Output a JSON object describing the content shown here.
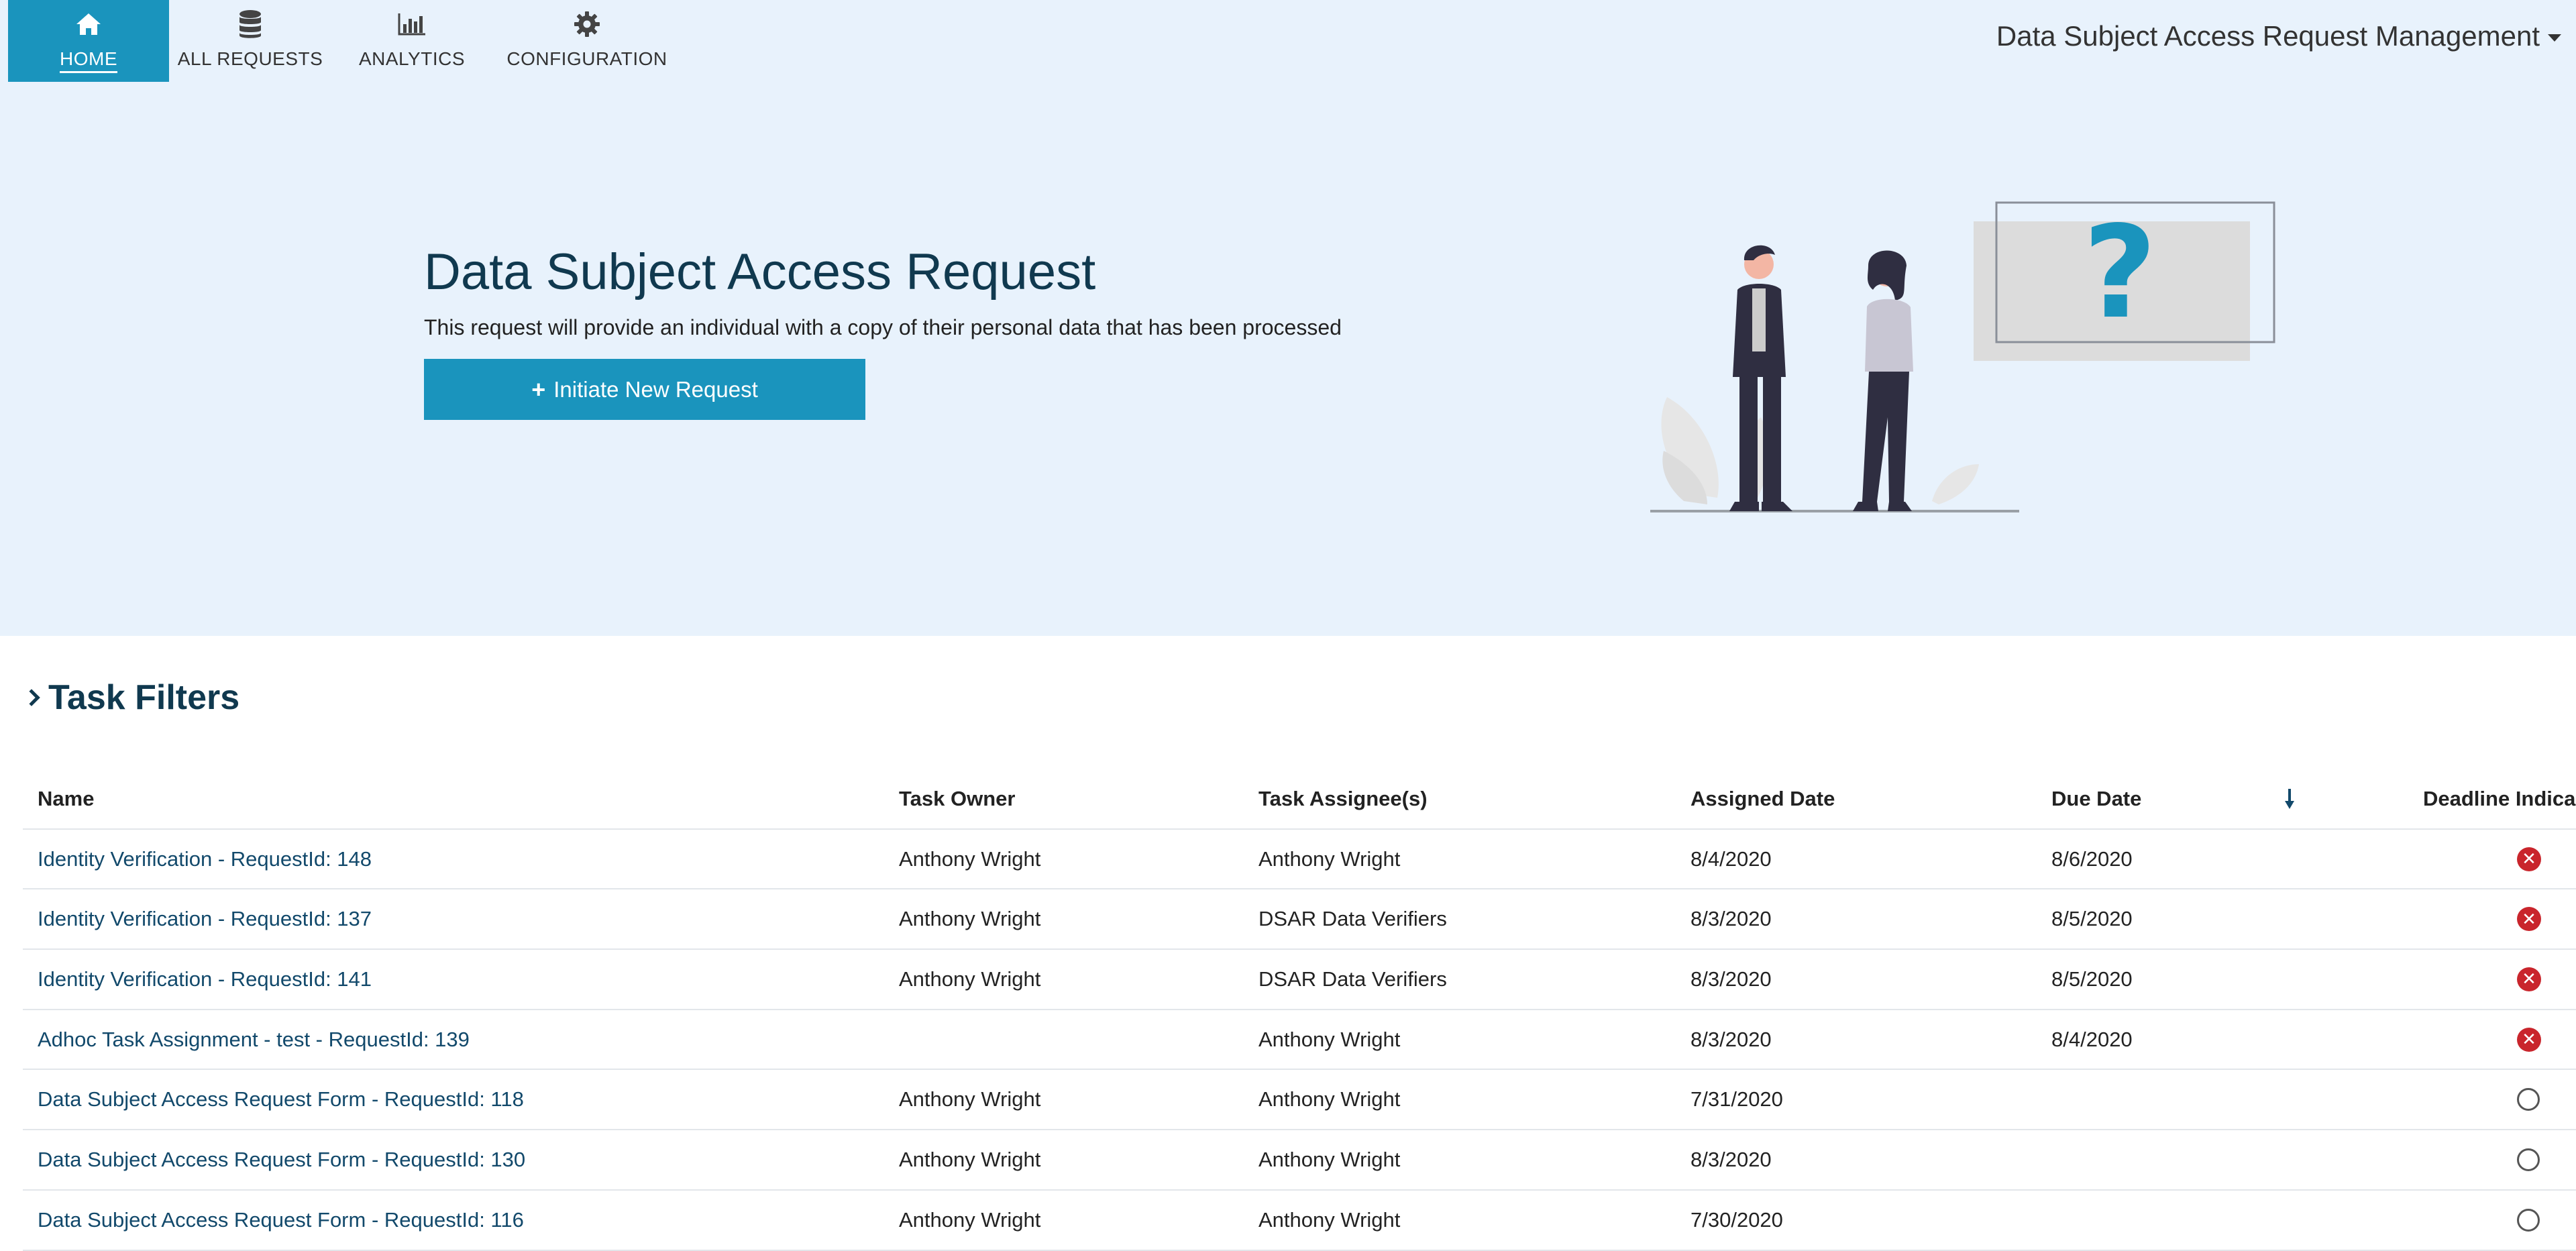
{
  "nav": {
    "items": [
      {
        "label": "HOME",
        "icon": "home-icon"
      },
      {
        "label": "ALL REQUESTS",
        "icon": "database-icon"
      },
      {
        "label": "ANALYTICS",
        "icon": "bar-chart-icon"
      },
      {
        "label": "CONFIGURATION",
        "icon": "gear-icon"
      }
    ],
    "app_title": "Data Subject Access Request Management"
  },
  "hero": {
    "title": "Data Subject Access Request",
    "description": "This request will provide an individual with a copy of their personal data that has been processed",
    "button_label": "Initiate New Request"
  },
  "filters": {
    "label": "Task Filters"
  },
  "table": {
    "headers": {
      "name": "Name",
      "owner": "Task Owner",
      "assignee": "Task Assignee(s)",
      "assigned": "Assigned Date",
      "due": "Due Date",
      "deadline": "Deadline Indica"
    },
    "rows": [
      {
        "name": "Identity Verification - RequestId: 148",
        "owner": "Anthony Wright",
        "assignee": "Anthony Wright",
        "assigned": "8/4/2020",
        "due": "8/6/2020",
        "status": "overdue"
      },
      {
        "name": "Identity Verification - RequestId: 137",
        "owner": "Anthony Wright",
        "assignee": "DSAR Data Verifiers",
        "assigned": "8/3/2020",
        "due": "8/5/2020",
        "status": "overdue"
      },
      {
        "name": "Identity Verification - RequestId: 141",
        "owner": "Anthony Wright",
        "assignee": "DSAR Data Verifiers",
        "assigned": "8/3/2020",
        "due": "8/5/2020",
        "status": "overdue"
      },
      {
        "name": "Adhoc Task Assignment - test - RequestId: 139",
        "owner": "",
        "assignee": "Anthony Wright",
        "assigned": "8/3/2020",
        "due": "8/4/2020",
        "status": "overdue"
      },
      {
        "name": "Data Subject Access Request Form - RequestId: 118",
        "owner": "Anthony Wright",
        "assignee": "Anthony Wright",
        "assigned": "7/31/2020",
        "due": "",
        "status": "none"
      },
      {
        "name": "Data Subject Access Request Form - RequestId: 130",
        "owner": "Anthony Wright",
        "assignee": "Anthony Wright",
        "assigned": "8/3/2020",
        "due": "",
        "status": "none"
      },
      {
        "name": "Data Subject Access Request Form - RequestId: 116",
        "owner": "Anthony Wright",
        "assignee": "Anthony Wright",
        "assigned": "7/30/2020",
        "due": "",
        "status": "none"
      }
    ]
  },
  "colors": {
    "accent": "#1a94bd",
    "hero_bg": "#e8f2fc",
    "heading": "#10394f",
    "link": "#12496b",
    "overdue": "#c9252c"
  }
}
